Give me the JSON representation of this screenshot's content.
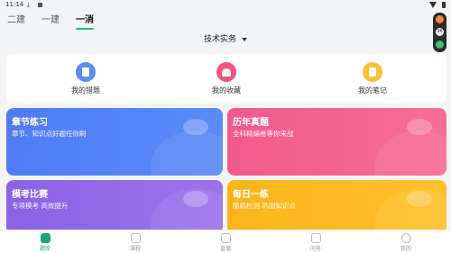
{
  "status_bar": {
    "time": "11:14",
    "download_glyph": "⤓"
  },
  "top_tabs": [
    {
      "label": "二建",
      "active": false
    },
    {
      "label": "一建",
      "active": false
    },
    {
      "label": "一消",
      "active": true
    }
  ],
  "subject_selector": {
    "label": "技术实务"
  },
  "float_widget": {
    "badge": "96"
  },
  "quick_actions": [
    {
      "label": "我的错题",
      "icon": "wrong-questions-icon",
      "color": "#5b8ef0"
    },
    {
      "label": "我的收藏",
      "icon": "favorites-icon",
      "color": "#f0567f"
    },
    {
      "label": "我的笔记",
      "icon": "notes-icon",
      "color": "#f6c23a"
    }
  ],
  "cards": [
    {
      "title": "章节练习",
      "subtitle": "章节、知识点好题任你刷"
    },
    {
      "title": "历年真题",
      "subtitle": "全科精编卷等你来战"
    },
    {
      "title": "模考比赛",
      "subtitle": "专项模考 高效提升"
    },
    {
      "title": "每日一练",
      "subtitle": "随机检测 巩固知识点"
    }
  ],
  "bottom_nav": [
    {
      "label": "题库",
      "active": true
    },
    {
      "label": "课程",
      "active": false
    },
    {
      "label": "直播",
      "active": false
    },
    {
      "label": "问答",
      "active": false
    },
    {
      "label": "我的",
      "active": false
    }
  ]
}
